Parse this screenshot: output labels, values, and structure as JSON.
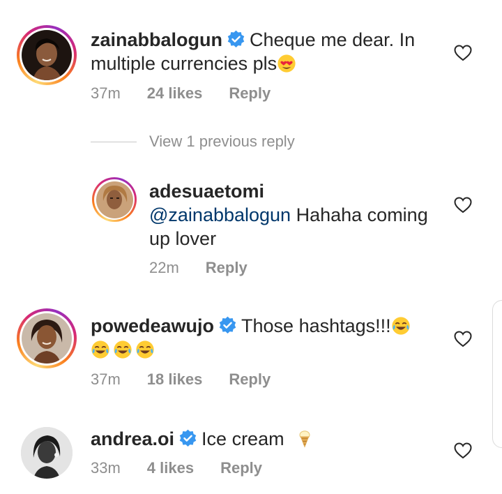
{
  "comments": [
    {
      "username": "zainabbalogun",
      "text_line1": "Cheque me dear. In",
      "text_line2": "multiple currencies pls",
      "time": "37m",
      "likes": "24 likes",
      "reply": "Reply"
    },
    {
      "username": "powedeawujo",
      "text": "Those hashtags!!!",
      "time": "37m",
      "likes": "18 likes",
      "reply": "Reply"
    },
    {
      "username": "andrea.oi",
      "text": "Ice cream",
      "time": "33m",
      "likes": "4 likes",
      "reply": "Reply"
    }
  ],
  "view_previous": "View 1 previous reply",
  "reply_item": {
    "username": "adesuaetomi",
    "mention": "@zainabbalogun",
    "text_line1": "Hahaha coming",
    "text_line2": "up lover",
    "time": "22m",
    "reply": "Reply"
  },
  "colors": {
    "verified": "#3897f0",
    "mention": "#00376b",
    "meta": "#8e8e8e"
  }
}
